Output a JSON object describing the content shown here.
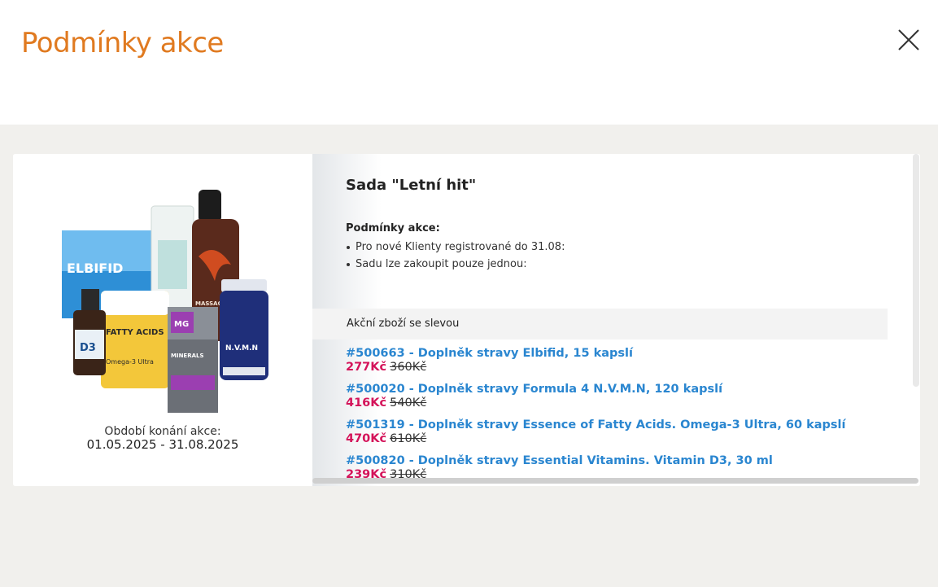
{
  "modal": {
    "title": "Podmínky akce",
    "close_icon": "close-icon"
  },
  "promo": {
    "image_icon": "product-bundle-image",
    "period_label": "Období konání akce:",
    "period_value": "01.05.2025 - 31.08.2025",
    "set_title": "Sada \"Letní hit\"",
    "conditions_heading": "Podmínky akce:",
    "conditions": [
      "Pro nové Klienty registrované do 31.08:",
      "Sadu lze zakoupit pouze jednou:"
    ],
    "discount_heading": "Akční zboží se slevou",
    "products": [
      {
        "name": "#500663 - Doplněk stravy Elbifid, 15 kapslí",
        "price_new": "277Kč",
        "price_old": "360Kč"
      },
      {
        "name": "#500020 - Doplněk stravy Formula 4 N.V.M.N, 120 kapslí",
        "price_new": "416Kč",
        "price_old": "540Kč"
      },
      {
        "name": "#501319 - Doplněk stravy Essence of Fatty Acids. Omega-3 Ultra, 60 kapslí",
        "price_new": "470Kč",
        "price_old": "610Kč"
      },
      {
        "name": "#500820 - Doplněk stravy Essential Vitamins. Vitamin D3, 30 ml",
        "price_new": "239Kč",
        "price_old": "310Kč"
      }
    ],
    "image_labels": {
      "elbifid": "ELBIFID",
      "fatty": "FATTY ACIDS",
      "omega": "Omega-3 Ultra",
      "mg": "MG",
      "minerals": "MINERALS",
      "nvmn": "N.V.M.N",
      "d3": "D3",
      "balsam": "MASSAGE BALSAM"
    }
  },
  "colors": {
    "title": "#e07a20",
    "link": "#2a86d0",
    "price_new": "#d4145a",
    "background": "#f1f0ed"
  }
}
